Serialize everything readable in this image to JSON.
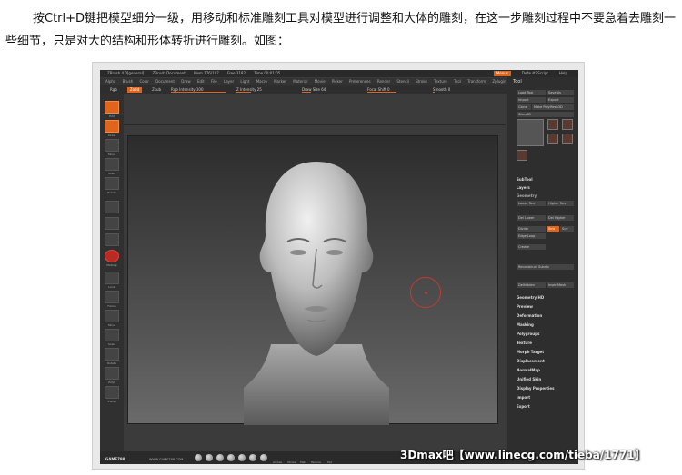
{
  "article": {
    "paragraph": "按Ctrl+D键把模型细分一级，用移动和标准雕刻工具对模型进行调整和大体的雕刻，在这一步雕刻过程中不要急着去雕刻一些细节，只是对大的结构和形体转折进行雕刻。如图："
  },
  "app": {
    "title_items": [
      "ZBrush 4.0[general]",
      "ZBrush Document",
      "Mem 176/197",
      "Free 3182",
      "Time 00:01:05"
    ],
    "menus": [
      "Alpha",
      "Brush",
      "Color",
      "Document",
      "Draw",
      "Edit",
      "File",
      "Layer",
      "Light",
      "Macro",
      "Marker",
      "Material",
      "Movie",
      "Picker",
      "Preferences",
      "Render",
      "Stencil",
      "Stroke",
      "Texture",
      "Tool",
      "Transform",
      "Zplugin",
      "Zscript"
    ],
    "right_buttons": [
      "Menus",
      "DefaultZScript",
      "Help"
    ],
    "shelf": {
      "rgb": "Rgb",
      "zadd": "Zadd",
      "zsub": "Zsub",
      "rgb_intensity": "Rgb Intensity 100",
      "z_intensity": "Z Intensity 25",
      "draw_size": "Draw Size 64",
      "focal_shift": "Focal Shift 0",
      "smooth": "Smooth 0"
    },
    "left_tray_labels": [
      "Edit",
      "Draw",
      "Move",
      "Scale",
      "Rotate",
      "MatCap",
      "Local",
      "Frame",
      "Move",
      "Scale",
      "Rotate",
      "PolyF",
      "Transp"
    ],
    "tool_panel": {
      "title": "Tool",
      "buttons": [
        "Load Tool",
        "Save As",
        "Import",
        "Export",
        "Clone",
        "Make PolyMesh3D"
      ],
      "model_label": "Stars3D",
      "sections_top": [
        "SubTool",
        "Layers",
        "Geometry"
      ],
      "geometry_buttons": [
        "Lower Res",
        "Higher Res",
        "Del Lower",
        "Del Higher",
        "Divide",
        "Smt",
        "Suv",
        "Edge Loop",
        "Crease",
        "Reconstruct Subdiv",
        "Delhidden",
        "InsertMesh"
      ],
      "sections": [
        "Geometry HD",
        "Preview",
        "Deformation",
        "Masking",
        "Polygroups",
        "Texture",
        "Morph Target",
        "Displacement",
        "NormalMap",
        "Unified Skin",
        "Display Properties",
        "Import",
        "Export"
      ]
    },
    "bottom": {
      "logo": "GAME798",
      "url": "WWW.GAME798.COM",
      "labels": [
        "Alphas",
        "Stroke",
        "Mats",
        "Texture",
        "Ppt"
      ]
    },
    "colors": {
      "accent": "#e0641c",
      "panel": "#2e2e2e"
    }
  },
  "watermark": "3Dmax吧【www.linecg.com/tieba/1771】"
}
